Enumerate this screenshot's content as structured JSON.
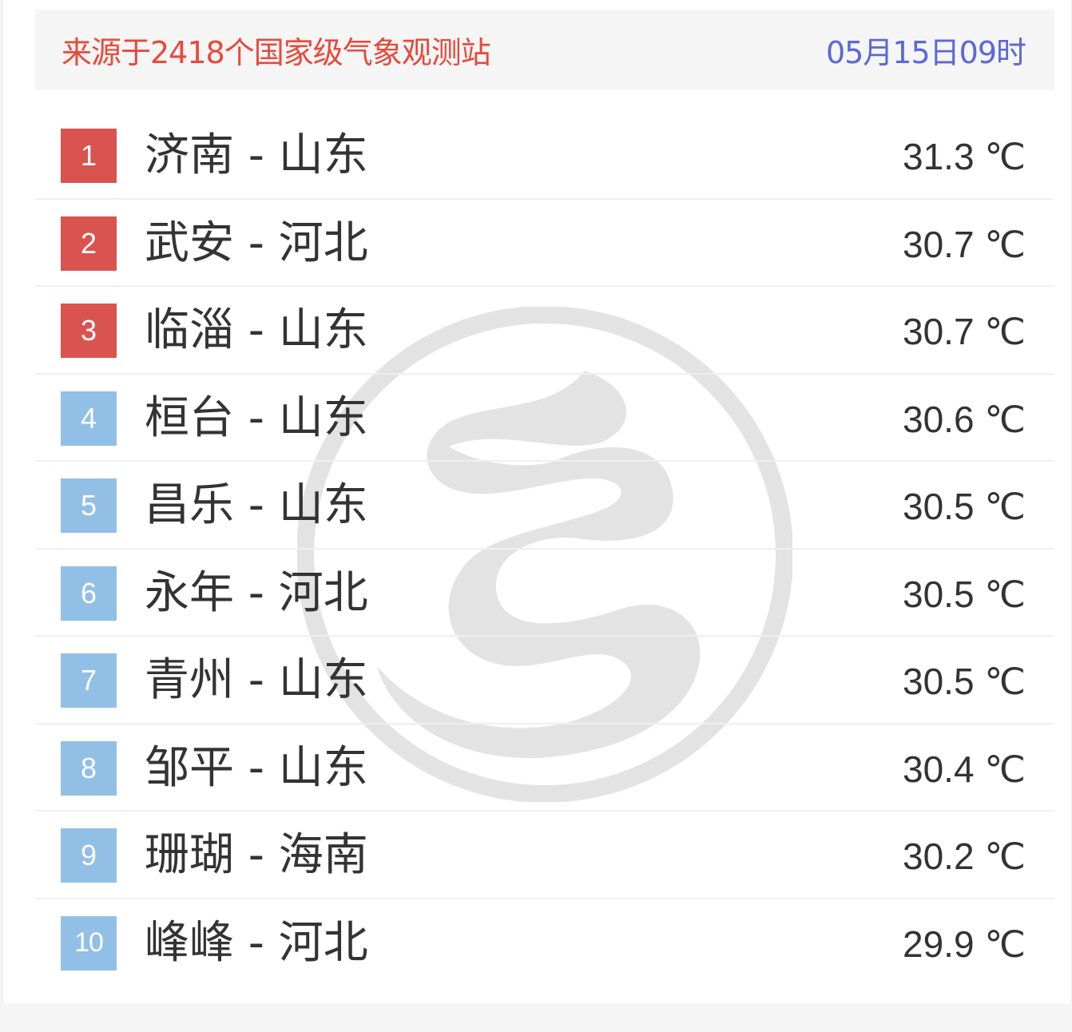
{
  "header": {
    "source": "来源于2418个国家级气象观测站",
    "time": "05月15日09时"
  },
  "rows": [
    {
      "rank": "1",
      "city": "济南 - 山东",
      "temp": "31.3 ℃"
    },
    {
      "rank": "2",
      "city": "武安 - 河北",
      "temp": "30.7 ℃"
    },
    {
      "rank": "3",
      "city": "临淄 - 山东",
      "temp": "30.7 ℃"
    },
    {
      "rank": "4",
      "city": "桓台 - 山东",
      "temp": "30.6 ℃"
    },
    {
      "rank": "5",
      "city": "昌乐 - 山东",
      "temp": "30.5 ℃"
    },
    {
      "rank": "6",
      "city": "永年 - 河北",
      "temp": "30.5 ℃"
    },
    {
      "rank": "7",
      "city": "青州 - 山东",
      "temp": "30.5 ℃"
    },
    {
      "rank": "8",
      "city": "邹平 - 山东",
      "temp": "30.4 ℃"
    },
    {
      "rank": "9",
      "city": "珊瑚 - 海南",
      "temp": "30.2 ℃"
    },
    {
      "rank": "10",
      "city": "峰峰 - 河北",
      "temp": "29.9 ℃"
    }
  ],
  "colors": {
    "rank_top3": "#d9534f",
    "rank_rest": "#92bfe6",
    "source_text": "#e8493b",
    "time_text": "#5b67d8"
  },
  "watermark_icon": "weather-logo-watermark-icon"
}
